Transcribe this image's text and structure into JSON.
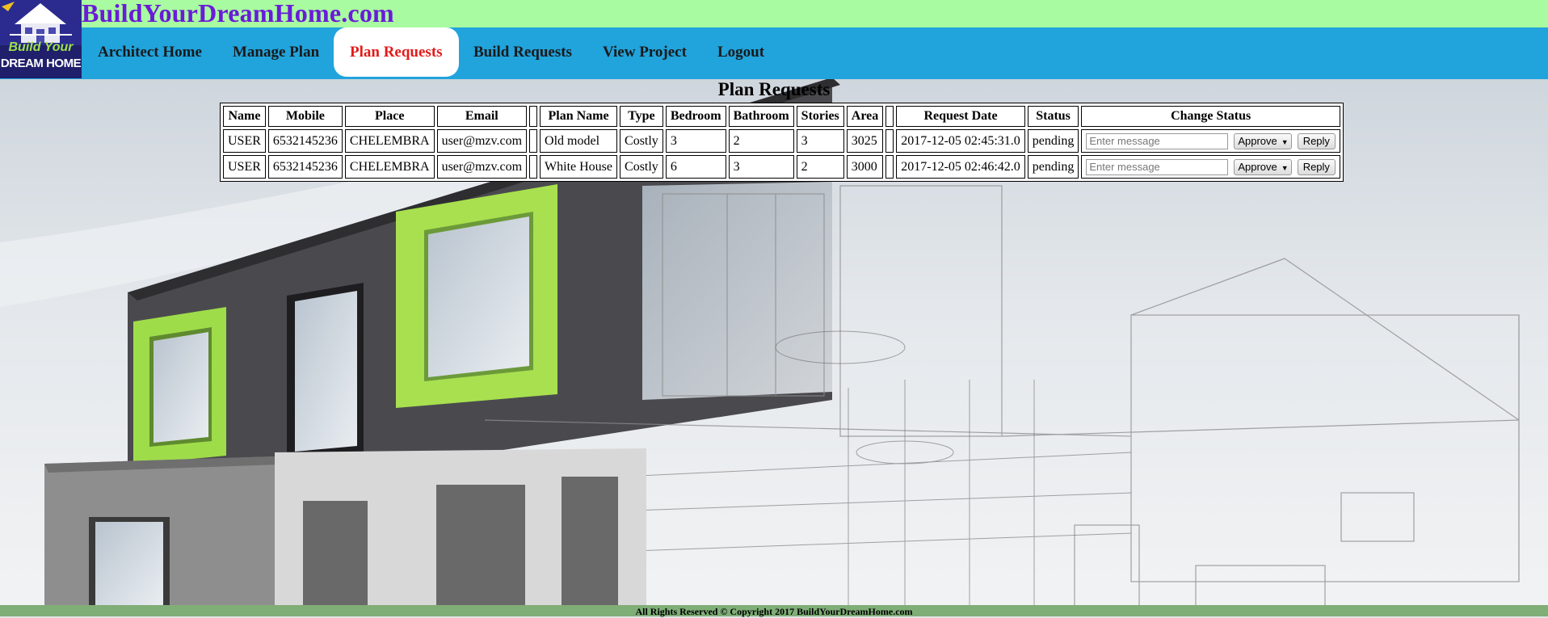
{
  "site": {
    "title": "BuildYourDreamHome.com",
    "logo_line1": "Build Your",
    "logo_line2": "DREAM HOME"
  },
  "nav": {
    "items": [
      {
        "label": "Architect Home"
      },
      {
        "label": "Manage Plan"
      },
      {
        "label": "Plan Requests"
      },
      {
        "label": "Build Requests"
      },
      {
        "label": "View Project"
      },
      {
        "label": "Logout"
      }
    ],
    "active": "Plan Requests"
  },
  "main": {
    "title": "Plan Requests",
    "columns": [
      "Name",
      "Mobile",
      "Place",
      "Email",
      "",
      "Plan Name",
      "Type",
      "Bedroom",
      "Bathroom",
      "Stories",
      "Area",
      "",
      "Request Date",
      "Status",
      "Change Status"
    ],
    "rows": [
      {
        "name": "USER",
        "mobile": "6532145236",
        "place": "CHELEMBRA",
        "email": "user@mzv.com",
        "plan_name": "Old model",
        "type": "Costly",
        "bedroom": "3",
        "bathroom": "2",
        "stories": "3",
        "area": "3025",
        "request_date": "2017-12-05 02:45:31.0",
        "status": "pending"
      },
      {
        "name": "USER",
        "mobile": "6532145236",
        "place": "CHELEMBRA",
        "email": "user@mzv.com",
        "plan_name": "White House",
        "type": "Costly",
        "bedroom": "6",
        "bathroom": "3",
        "stories": "2",
        "area": "3000",
        "request_date": "2017-12-05 02:46:42.0",
        "status": "pending"
      }
    ],
    "controls": {
      "message_placeholder": "Enter message",
      "selected_action": "Approve",
      "reply_label": "Reply"
    }
  },
  "footer": {
    "text": "All Rights Reserved © Copyright 2017 BuildYourDreamHome.com"
  },
  "colors": {
    "topbar": "#a8fba0",
    "navbar": "#21a3dc",
    "title": "#6a1bd8",
    "active_nav": "#e21b1b",
    "footer": "#7fae77"
  }
}
